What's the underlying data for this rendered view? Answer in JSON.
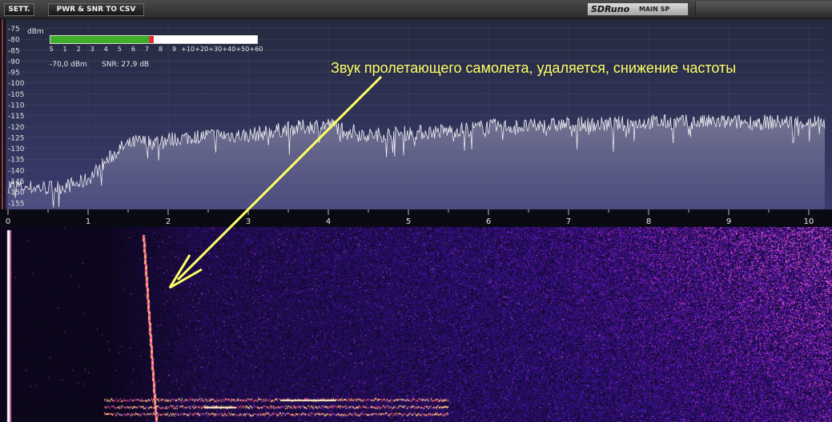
{
  "toolbar": {
    "settings_label": "SETT.",
    "csv_label": "PWR & SNR TO CSV",
    "logo_brand": "SDRuno",
    "logo_mode": "MAIN SP"
  },
  "smeter": {
    "unit": "dBm",
    "ticks": [
      "S",
      "1",
      "2",
      "3",
      "4",
      "5",
      "6",
      "7",
      "8",
      "9",
      "+10",
      "+20",
      "+30",
      "+40",
      "+50",
      "+60"
    ],
    "fill_fraction": 0.5,
    "level_text": "-70,0 dBm",
    "snr_text": "SNR: 27,9 dB"
  },
  "annotation": {
    "text": "Звук пролетающего самолета, удаляется, снижение частоты",
    "color": "#ffff66"
  },
  "colors": {
    "spectrum_bg_top": "#252a3f",
    "spectrum_bg_bottom": "#3c3c73",
    "trace": "#ffffff",
    "waterfall_low": "#000014",
    "waterfall_mid": "#2a1a9a",
    "waterfall_high": "#ff6030"
  },
  "chart_data": {
    "type": "line",
    "y_ticks": [
      "-75",
      "-80",
      "-85",
      "-90",
      "-95",
      "-100",
      "-105",
      "-110",
      "-115",
      "-120",
      "-125",
      "-130",
      "-135",
      "-140",
      "-145",
      "-150",
      "-155"
    ],
    "x_ticks": [
      "0",
      "1",
      "2",
      "3",
      "4",
      "5",
      "6",
      "7",
      "8",
      "9",
      "10"
    ],
    "xlim": [
      0,
      10.2
    ],
    "ylim": [
      -158,
      -73
    ],
    "grid": true,
    "series": [
      {
        "x": [
          0,
          0.3,
          0.6,
          0.9,
          1.0,
          1.2,
          1.4,
          1.6,
          1.8,
          2.0,
          2.5,
          3.0,
          3.5,
          4.0,
          4.5,
          5.0,
          5.5,
          6.0,
          6.5,
          7.0,
          7.5,
          8.0,
          8.5,
          9.0,
          9.5,
          10.0,
          10.2
        ],
        "y": [
          -147,
          -148,
          -148,
          -146,
          -144,
          -137,
          -130,
          -127,
          -127,
          -126,
          -124,
          -124,
          -121,
          -119,
          -124,
          -123,
          -122,
          -120,
          -120,
          -119,
          -119,
          -118,
          -118,
          -118,
          -118,
          -118,
          -118
        ]
      }
    ]
  }
}
